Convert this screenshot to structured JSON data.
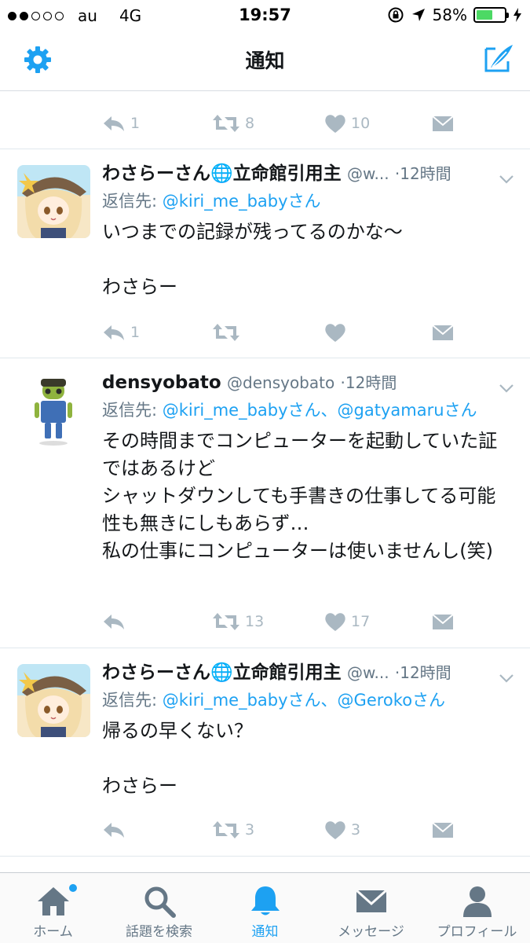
{
  "status_bar": {
    "carrier": "au",
    "network": "4G",
    "time": "19:57",
    "battery_text": "58%",
    "battery_level": 0.58
  },
  "nav": {
    "title": "通知",
    "accent_color": "#1da1f2"
  },
  "partial_tweet": {
    "reply_count": "1",
    "retweet_count": "8",
    "like_count": "10"
  },
  "tweets": [
    {
      "display_name": "わさらーさん🌐立命館引用主",
      "handle": "@w...",
      "time": "12時間",
      "reply_prefix": "返信先:",
      "mentions": "@kiri_me_babyさん",
      "text": "いつまでの記録が残ってるのかな～\n\nわさらー",
      "reply_count": "1",
      "retweet_count": "",
      "like_count": ""
    },
    {
      "display_name": "densyobato",
      "handle": "@densyobato",
      "time": "12時間",
      "reply_prefix": "返信先:",
      "mentions": "@kiri_me_babyさん、@gatyamaruさん",
      "text": "その時間までコンピューターを起動していた証ではあるけど\nシャットダウンしても手書きの仕事してる可能性も無きにしもあらず…\n私の仕事にコンピューターは使いませんし(笑)",
      "reply_count": "",
      "retweet_count": "13",
      "like_count": "17"
    },
    {
      "display_name": "わさらーさん🌐立命館引用主",
      "handle": "@w...",
      "time": "12時間",
      "reply_prefix": "返信先:",
      "mentions": "@kiri_me_babyさん、@Gerokoさん",
      "text": "帰るの早くない？\n\nわさらー",
      "reply_count": "",
      "retweet_count": "3",
      "like_count": "3"
    }
  ],
  "tabs": [
    {
      "label": "ホーム",
      "icon": "home-icon"
    },
    {
      "label": "話題を検索",
      "icon": "search-icon"
    },
    {
      "label": "通知",
      "icon": "bell-icon"
    },
    {
      "label": "メッセージ",
      "icon": "envelope-icon"
    },
    {
      "label": "プロフィール",
      "icon": "person-icon"
    }
  ]
}
